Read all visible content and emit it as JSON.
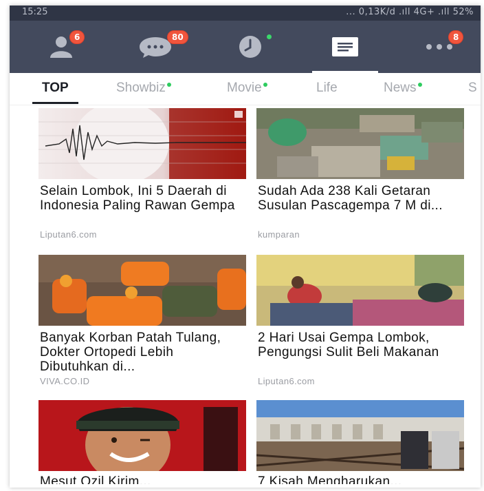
{
  "status_bar": {
    "time": "15:25",
    "indicators": "... 0,13K/d  .ıll 4G+ .ıll  52%"
  },
  "top_bar": {
    "items": [
      {
        "icon": "friends-icon",
        "badge": "6"
      },
      {
        "icon": "chat-icon",
        "badge": "80"
      },
      {
        "icon": "timeline-icon",
        "has_new_dot": true
      },
      {
        "icon": "news-icon",
        "active": true
      },
      {
        "icon": "more-icon",
        "badge": "8"
      }
    ],
    "badge_color": "#f0553d",
    "background": "#434a5d"
  },
  "tabs": [
    {
      "label": "TOP",
      "active": true
    },
    {
      "label": "Showbiz",
      "has_new_dot": true
    },
    {
      "label": "Movie",
      "has_new_dot": true
    },
    {
      "label": "Life"
    },
    {
      "label": "News",
      "has_new_dot": true
    },
    {
      "label": "S"
    }
  ],
  "articles": [
    {
      "headline": "Selain Lombok, Ini 5 Daerah di Indonesia Paling Rawan Gempa",
      "source": "Liputan6.com",
      "image": "seismograph"
    },
    {
      "headline": "Sudah Ada 238 Kali Getaran Susulan Pascagempa 7 M di...",
      "source": "kumparan",
      "image": "collapsed-mosque-aerial"
    },
    {
      "headline": "Banyak Korban Patah Tulang, Dokter Ortopedi Lebih Dibutuhkan di...",
      "source": "VIVA.CO.ID",
      "image": "rescue-workers"
    },
    {
      "headline": "2 Hari Usai Gempa Lombok, Pengungsi Sulit Beli Makanan",
      "source": "Liputan6.com",
      "image": "refugee-tent"
    },
    {
      "headline": "Mesut Ozil Kirim...",
      "source": "",
      "image": "footballer-wink"
    },
    {
      "headline": "7 Kisah Mengharukan...",
      "source": "",
      "image": "damaged-mosque"
    }
  ]
}
